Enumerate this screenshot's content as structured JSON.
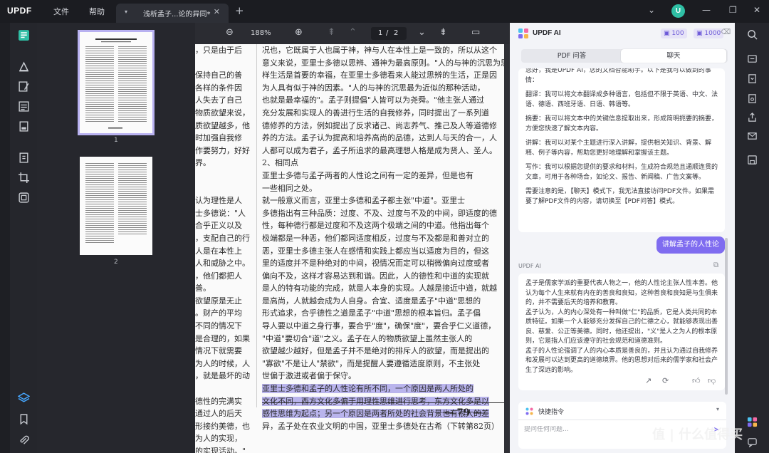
{
  "titlebar": {
    "logo_main": "UPDF",
    "menu": [
      "文件",
      "帮助"
    ],
    "tab_title": "浅析孟子...论的异同*",
    "avatar_letter": "U"
  },
  "left_tools": [
    "reader-icon",
    "comment-icon",
    "edit-icon",
    "organize-icon",
    "form-icon",
    "protect-icon",
    "crop-icon",
    "ocr-icon",
    "layers-icon",
    "bookmark-icon",
    "attachment-icon"
  ],
  "thumbnails": {
    "pages": [
      "1",
      "2"
    ]
  },
  "viewer": {
    "zoom": "188%",
    "page_current": "1",
    "page_sep": "/",
    "page_total": "2",
    "left_column_lines": [
      "，只是由于后",
      "",
      "保持自己的善",
      "各样的条件因",
      "人失去了自己",
      "物质欲望来说，",
      "质欲望越多，他",
      "时加强自我修",
      "作要努力，好好",
      "界。",
      "",
      "",
      "认为理性是人",
      "士多德说：\"人",
      "合乎正义以及",
      "，支配自己的行",
      "人是在本性上",
      "人和威胁之中。",
      "，他们都把人",
      "善。",
      "欲望原是无止",
      "。财产的平均",
      "不同的情况下",
      "是合理的，如果",
      "情况下就需要",
      "为人的时候，人",
      "，就是最坏的动",
      "",
      "德性的完满实",
      "通过人的后天",
      "形接约美德，也",
      "为人的实现，",
      "的实现活动。\""
    ],
    "right_column_lines": [
      "况也，它既属于人也属于神，神与人在本性上是一致的，所以从这个",
      "意义来说，亚里士多德以思辨、通神为最高原则。\"人的与神的沉思为思辨",
      "样生活是首要的幸福，在亚里士多德看来人能过思辨的生活，正是因",
      "为人具有似于神的因素。\"人的与神的沉思最为近似的那种活动，",
      "也就是最幸福的\"。孟子则提倡\"人皆可以为尧舜。\"他主张人通过",
      "充分发展和实现人的善进行生活的自我修养，同时提出了一系列道",
      "德修养的方法，例如提出了反求诸己、尚志养气、推己及人等道德修",
      "养的方法。孟子认为提高和培养高尚的品德，达到人与天的合一，人",
      "人都可以成为君子，孟子所追求的最高理想人格是成为贤人、圣人。",
      "        2、相同点",
      "    亚里士多德与孟子两者的人性论之间有一定的差异，但是也有",
      "一些相同之处。",
      "    就一般意义而言，亚里士多德和孟子都主张\"中道\"。亚里士",
      "多德指出有三种品质：过度、不及、过度与不及的中间，即适度的德",
      "性，每种德行都是过度和不及这两个极端之间的中道。他指出每个",
      "极端都是一种恶，他们都同适度相反，过度与不及都是和善对立的",
      "恶，亚里士多德主张人在感情和实践上都应当以适度为目的，但这",
      "里的适度并不是种绝对的中间，视情况而定可以稍微偏向过度或者",
      "偏向不及，这样才容易达到和谐。因此，人的德性和中道的实现就",
      "是人的特有功能的完成，就是人本身的实现。人越是接近中道，就越",
      "是高尚，人就越会成为人自身。合宜、适度是孟子\"中道\"思想的",
      "形式追求，合乎德性之道是孟子\"中道\"思想的根本旨归。孟子倡",
      "导人要以中道之身行事，要合乎\"度\"，确保\"度\"，要合乎仁义道德，",
      "\"中道\"要切合\"道\"之义。孟子在人的物质欲望上虽然主张人的",
      "欲望越少越好，但是孟子并不是绝对的排斥人的欲望，而是提出的",
      "\"寡欲\"不是让人\"禁欲\"，而是提醒人要遵循适度原则，不主张处",
      "世偏于激进或者偏于保守。",
      "    亚里士多德和孟子的人性论有所不同，一个原因是两人所处的",
      "文化不同，西方文化多偏于用理性思维进行思考，东方文化多是以",
      "感性思维为起点；另一个原因是两者所处的社会背景也有很大的差",
      "异，孟子处在农业文明的中国，亚里士多德处在古希（下转第82页）"
    ],
    "highlighted_lines": [
      27,
      28,
      29
    ],
    "page_number": "— 79 —"
  },
  "ai": {
    "title": "UPDF AI",
    "credit_1": "100",
    "credit_2": "1000",
    "tabs": [
      "PDF 问答",
      "聊天"
    ],
    "active_tab": "聊天",
    "intro": [
      "您好，我是UPDF AI，您的文档智能助手。以下是我可以做到的事情：",
      "翻译：我可以将文本翻译成多种语言，包括但不限于英语、中文、法语、德语、西班牙语、日语、韩语等。",
      "摘要：我可以将文本中的关键信息提取出来，形成简明扼要的摘要，方便您快速了解文本内容。",
      "讲解：我可以对某个主题进行深入讲解，提供相关知识、背景、解释、例子等内容，帮助您更好地理解和掌握该主题。",
      "写作：我可以根据您提供的要求和材料，生成符合规范且通顺连贯的文章，可用于各种场合，如论文、报告、新闻稿、广告文案等。",
      "需要注意的是，【聊天】模式下，我无法直接访问PDF文件。如果需要了解PDF文件的内容，请切换至【PDF问答】模式。"
    ],
    "user_message": "讲解孟子的人性论",
    "answer_label": "UPDF AI",
    "answer": [
      "孟子是儒家学派的重要代表人物之一，他的人性论主张人性本善。他认为每个人生来就有内在的善良和良知，这种善良和良知是与生俱来的，并不需要后天的培养和教育。",
      "孟子认为，人的内心深处有一种叫做\"仁\"的品质，它是人类共同的本质特征。如果一个人能够充分发挥自己的仁德之心，就能够表现出善良、慈爱、公正等美德。同时，他还提出，\"义\"是人之为人的根本原则，它是指人们应该遵守的社会规范和道德准则。",
      "孟子的人性论强调了人的内心本质是善良的，并且认为通过自我修养和发展可以达到更高的道德境界。他的思想对后来的儒学家和社会产生了深远的影响。"
    ],
    "quick_label": "快捷指令",
    "input_placeholder": "提问任何问题..."
  },
  "right_tools": [
    "search-icon",
    "ocr-icon",
    "convert-icon",
    "protect-icon",
    "share-icon",
    "email-icon",
    "save-icon",
    "ai-icon",
    "chat-icon"
  ],
  "watermark": "值 | 什么值得买",
  "colors": {
    "accent": "#7f6cf0",
    "highlight": "#b9b4ec",
    "dark_bg": "#1e1f24"
  }
}
